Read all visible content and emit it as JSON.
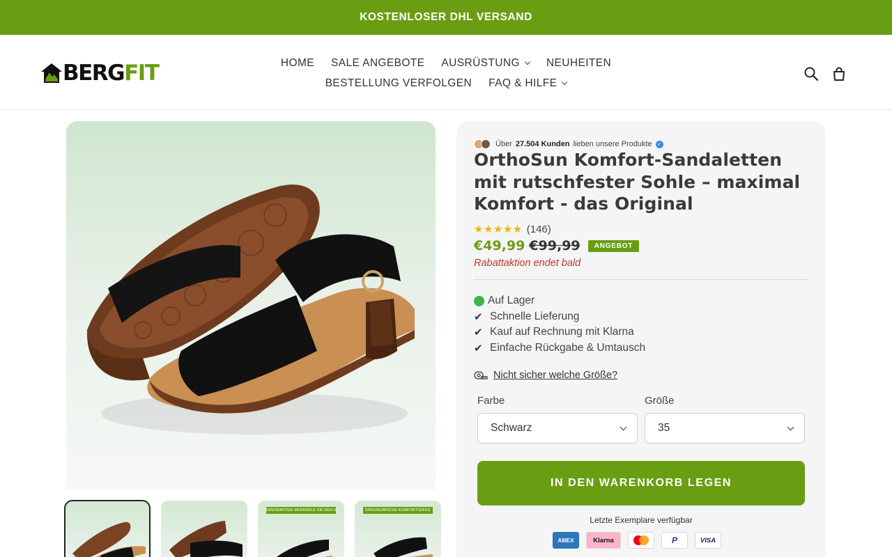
{
  "announcement": "KOSTENLOSER DHL VERSAND",
  "logo": {
    "part1": "BERG",
    "part2": "FIT"
  },
  "nav": {
    "row1": [
      {
        "label": "HOME",
        "dropdown": false
      },
      {
        "label": "SALE ANGEBOTE",
        "dropdown": false
      },
      {
        "label": "AUSRÜSTUNG",
        "dropdown": true
      },
      {
        "label": "NEUHEITEN",
        "dropdown": false
      }
    ],
    "row2": [
      {
        "label": "BESTELLUNG VERFOLGEN",
        "dropdown": false
      },
      {
        "label": "FAQ & HILFE",
        "dropdown": true
      }
    ]
  },
  "header_icons": [
    "search-icon",
    "cart-icon"
  ],
  "gallery": {
    "thumbnails": [
      {
        "banner": ""
      },
      {
        "banner": ""
      },
      {
        "banner": "EINZIGARTIGE MERKMALE DIE DEN UNTERSCHIED MACHEN"
      },
      {
        "banner": "ERGONOMISCHE KOMFORTSOHLE"
      }
    ]
  },
  "product": {
    "trust_prefix": "Über",
    "trust_bold": "27.504 Kunden",
    "trust_suffix": "lieben unsere Produkte",
    "title": "OrthoSun Komfort-Sandaletten mit rutschfester Sohle – maximal Komfort - das Original",
    "stars": "★★★★★",
    "rating_count": "(146)",
    "price": "€49,99",
    "compare_price": "€99,99",
    "badge": "ANGEBOT",
    "promo": "Rabattaktion endet bald",
    "features": [
      "Auf Lager",
      "Schnelle Lieferung",
      "Kauf auf Rechnung mit Klarna",
      "Einfache Rückgabe & Umtausch"
    ],
    "size_guide_link": "Nicht sicher welche Größe?",
    "color_label": "Farbe",
    "color_value": "Schwarz",
    "size_label": "Größe",
    "size_value": "35",
    "add_to_cart": "IN DEN WARENKORB LEGEN",
    "stock_note": "Letzte Exemplare verfügbar",
    "payments": [
      "AMEX",
      "Klarna",
      "Mastercard",
      "P",
      "VISA"
    ]
  },
  "colors": {
    "brand_green": "#6a9e12",
    "promo_red": "#c0392b",
    "star": "#f0b400"
  }
}
